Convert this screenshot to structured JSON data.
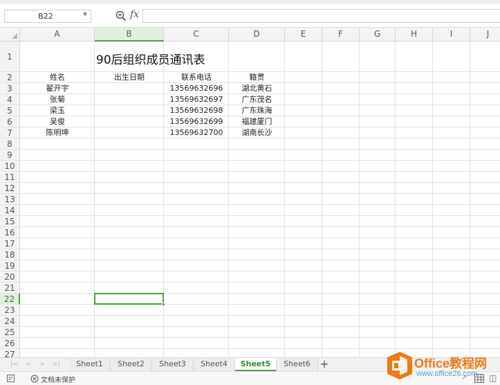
{
  "formula_bar": {
    "name_box": "B22",
    "fx_label": "fx",
    "formula_value": ""
  },
  "columns": [
    "A",
    "B",
    "C",
    "D",
    "E",
    "F",
    "G",
    "H",
    "I",
    "J"
  ],
  "selected_column": "B",
  "rows": [
    "1",
    "2",
    "3",
    "4",
    "5",
    "6",
    "7",
    "8",
    "9",
    "10",
    "11",
    "12",
    "13",
    "14",
    "15",
    "16",
    "17",
    "18",
    "19",
    "20",
    "21",
    "22",
    "23",
    "24",
    "25",
    "26",
    "27"
  ],
  "selected_row": "22",
  "sheet": {
    "title": "90后组织成员通讯表",
    "headers": {
      "name": "姓名",
      "birth_date": "出生日期",
      "phone": "联系电话",
      "origin": "籍贯"
    },
    "records": [
      {
        "name": "翟开宇",
        "birth_date": "",
        "phone": "13569632696",
        "origin": "湖北黄石"
      },
      {
        "name": "张菊",
        "birth_date": "",
        "phone": "13569632697",
        "origin": "广东茂名"
      },
      {
        "name": "梁玉",
        "birth_date": "",
        "phone": "13569632698",
        "origin": "广东珠海"
      },
      {
        "name": "吴俊",
        "birth_date": "",
        "phone": "13569632699",
        "origin": "福建厦门"
      },
      {
        "name": "陈明坤",
        "birth_date": "",
        "phone": "13569632700",
        "origin": "湖南长沙"
      }
    ]
  },
  "sheet_tabs": [
    "Sheet1",
    "Sheet2",
    "Sheet3",
    "Sheet4",
    "Sheet5",
    "Sheet6"
  ],
  "active_sheet": "Sheet5",
  "add_sheet_label": "+",
  "status_bar": {
    "protection_text": "文档未保护"
  },
  "watermark": {
    "title": "Office教程网",
    "url": "www.office26.com"
  },
  "colors": {
    "accent_green": "#4c9e3e",
    "watermark_orange": "#f07a14",
    "watermark_blue": "#5a9bd5"
  }
}
